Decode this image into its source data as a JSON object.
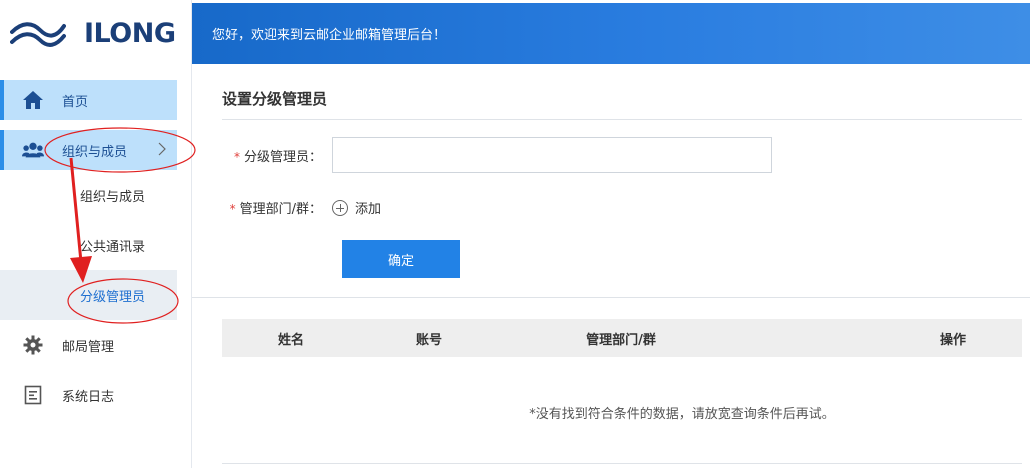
{
  "brand": {
    "logo_text": "ILONG"
  },
  "header": {
    "welcome": "您好，欢迎来到云邮企业邮箱管理后台！"
  },
  "sidebar": {
    "home": "首页",
    "org": "组织与成员",
    "sub_items": [
      "组织与成员",
      "公共通讯录",
      "分级管理员"
    ],
    "office": "邮局管理",
    "logs": "系统日志"
  },
  "main": {
    "title": "设置分级管理员",
    "admin_label": "分级管理员：",
    "admin_value": "",
    "dept_label": "管理部门/群：",
    "add_label": "添加",
    "confirm": "确定",
    "required_mark": "*"
  },
  "table": {
    "columns": [
      "姓名",
      "账号",
      "管理部门/群",
      "操作"
    ],
    "empty_text": "*没有找到符合条件的数据，请放宽查询条件后再试。"
  },
  "colors": {
    "accent": "#2282e6",
    "header": "#1769c9",
    "annotation": "#e02020"
  }
}
